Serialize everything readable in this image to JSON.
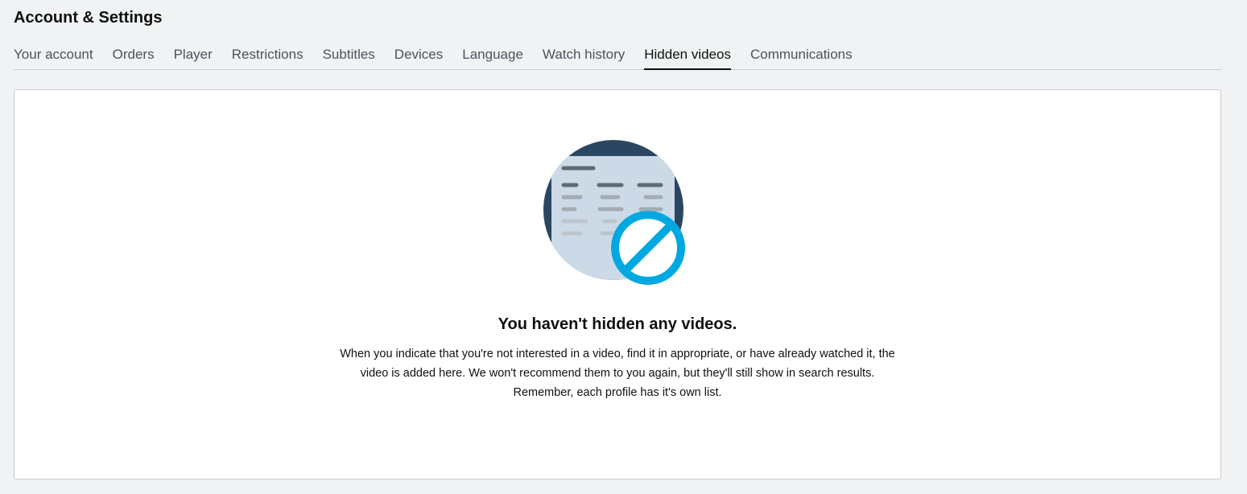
{
  "header": {
    "title": "Account & Settings"
  },
  "tabs": [
    {
      "label": "Your account",
      "active": false
    },
    {
      "label": "Orders",
      "active": false
    },
    {
      "label": "Player",
      "active": false
    },
    {
      "label": "Restrictions",
      "active": false
    },
    {
      "label": "Subtitles",
      "active": false
    },
    {
      "label": "Devices",
      "active": false
    },
    {
      "label": "Language",
      "active": false
    },
    {
      "label": "Watch history",
      "active": false
    },
    {
      "label": "Hidden videos",
      "active": true
    },
    {
      "label": "Communications",
      "active": false
    }
  ],
  "empty_state": {
    "icon": "hidden-list-blocked-icon",
    "title": "You haven't hidden any videos.",
    "description_lines": [
      "When you indicate that you're not interested in a video, find it in appropriate, or have already watched it, the",
      "video is added here. We won't recommend them to you again, but they'll still show in search results.",
      "Remember, each profile has it's own list."
    ]
  },
  "colors": {
    "page_background": "#f0f2f4",
    "circle": "#2b4660",
    "card": "#ccdae8",
    "block_symbol": "#00a8e1",
    "text": "#0f1111",
    "tab_text": "#4a545e"
  }
}
